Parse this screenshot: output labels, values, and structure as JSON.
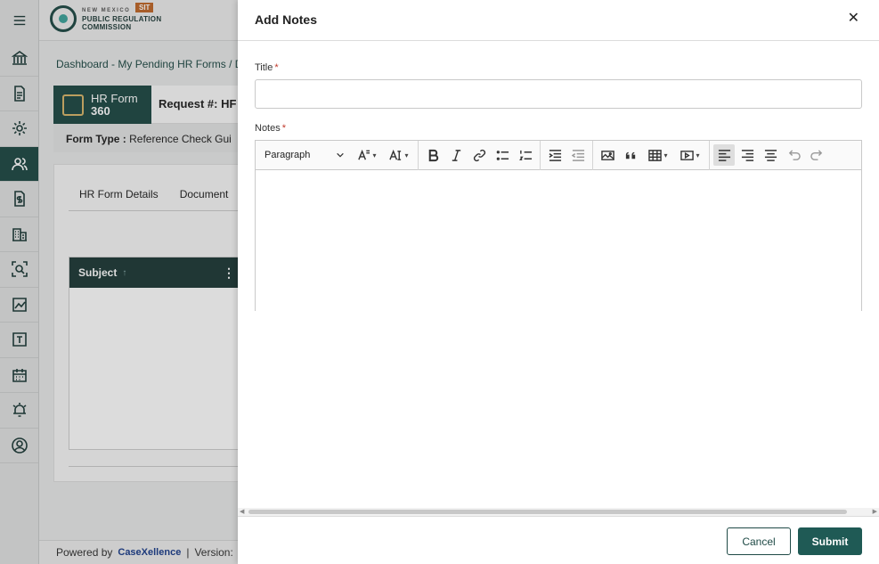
{
  "app": {
    "logo_small": "NEW MEXICO",
    "logo_line1": "PUBLIC REGULATION",
    "logo_line2": "COMMISSION",
    "env_badge": "SIT"
  },
  "rail": {
    "items": [
      {
        "icon": "building-icon"
      },
      {
        "icon": "document-icon"
      },
      {
        "icon": "settings-icon"
      },
      {
        "icon": "users-icon",
        "active": true
      },
      {
        "icon": "invoice-icon"
      },
      {
        "icon": "office-icon"
      },
      {
        "icon": "search-person-icon"
      },
      {
        "icon": "chart-icon"
      },
      {
        "icon": "template-icon"
      },
      {
        "icon": "calendar-icon"
      },
      {
        "icon": "alarm-icon"
      },
      {
        "icon": "profile-icon"
      }
    ]
  },
  "page": {
    "breadcrumb": "Dashboard - My Pending HR Forms / D",
    "hr_form_line1": "HR Form",
    "hr_form_line2": "360",
    "request_title": "Request #: HF",
    "form_type_label": "Form Type :",
    "form_type_value": "Reference Check Gui",
    "tabs": [
      "HR Form Details",
      "Document"
    ],
    "grid_column": "Subject",
    "footer_powered": "Powered by",
    "footer_brand": "CaseXellence",
    "footer_sep": "|",
    "footer_version": "Version:"
  },
  "drawer": {
    "title": "Add Notes",
    "close_glyph": "✕",
    "title_label": "Title",
    "title_value": "",
    "title_placeholder": "",
    "notes_label": "Notes",
    "required_mark": "*",
    "toolbar": {
      "block_format": "Paragraph"
    },
    "cancel_label": "Cancel",
    "submit_label": "Submit"
  }
}
